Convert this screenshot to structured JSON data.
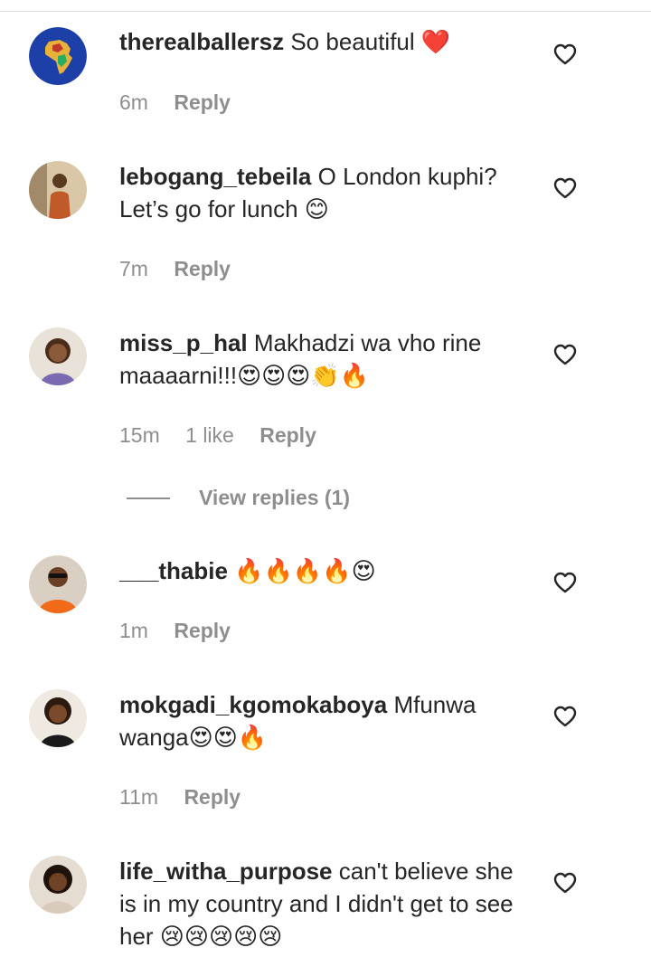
{
  "comments": [
    {
      "username": "therealballersz",
      "text": "So beautiful ❤️",
      "time": "6m",
      "likes": "",
      "reply": "Reply",
      "avatar_icon": "africa-map-avatar"
    },
    {
      "username": "lebogang_tebeila",
      "text": "O London kuphi? Let’s go for lunch 😊",
      "time": "7m",
      "likes": "",
      "reply": "Reply",
      "avatar_icon": "person-photo-avatar"
    },
    {
      "username": "miss_p_hal",
      "text": "Makhadzi wa vho rine maaaarni!!!😍😍😍👏🔥",
      "time": "15m",
      "likes": "1 like",
      "reply": "Reply",
      "avatar_icon": "person-photo-avatar"
    },
    {
      "username": "___thabie",
      "text": "🔥🔥🔥🔥😍",
      "time": "1m",
      "likes": "",
      "reply": "Reply",
      "avatar_icon": "person-photo-avatar"
    },
    {
      "username": "mokgadi_kgomokaboya",
      "text": "Mfunwa wanga😍😍🔥",
      "time": "11m",
      "likes": "",
      "reply": "Reply",
      "avatar_icon": "person-photo-avatar"
    },
    {
      "username": "life_witha_purpose",
      "text": "can't believe she is in my country and I didn't get to see her 😢😢😢😢😢",
      "time": "",
      "likes": "",
      "reply": "",
      "avatar_icon": "person-photo-avatar"
    }
  ],
  "view_replies": "View replies (1)",
  "colors": {
    "text": "#262626",
    "muted": "#8e8e8e",
    "heart_stroke": "#262626"
  }
}
